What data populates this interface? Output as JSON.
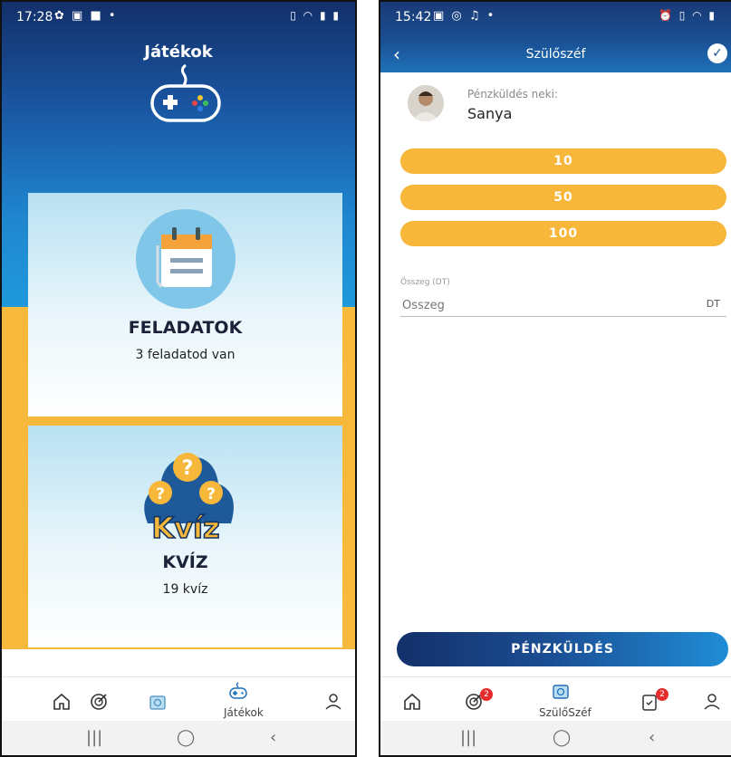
{
  "left_screen": {
    "status_time": "17:28",
    "status_icons": "✿ ▣ ■ •",
    "status_system": "▯ ◠ ▮ ▮",
    "header_title": "Játékok",
    "cards": [
      {
        "title": "FELADATOK",
        "subtitle": "3 feladatod van"
      },
      {
        "title": "KVÍZ",
        "subtitle": "19 kvíz",
        "logo_text": "Kvíz"
      }
    ],
    "nav": {
      "active_label": "Játékok",
      "items": [
        "home-icon",
        "target-icon",
        "wallet-icon",
        "gamepad-icon",
        "profile-icon"
      ]
    }
  },
  "right_screen": {
    "status_time": "15:42",
    "status_icons": "▣ ◎ ♫ •",
    "status_system": "⏰ ▯ ◠ ▮",
    "header_title": "Szülőszéf",
    "recipient_label": "Pénzküldés neki:",
    "recipient_name": "Sanya",
    "amount_buttons": [
      "10",
      "50",
      "100"
    ],
    "amount_field": {
      "label": "Összeg (DT)",
      "placeholder": "Összeg",
      "suffix": "DT"
    },
    "send_button": "PÉNZKÜLDÉS",
    "nav": {
      "active_label": "SzülőSzéf",
      "badges": [
        "2",
        "2"
      ]
    }
  },
  "colors": {
    "navy": "#13306a",
    "blue": "#1f86cf",
    "yellow": "#f6b73a",
    "badge_red": "#e52b2b"
  }
}
